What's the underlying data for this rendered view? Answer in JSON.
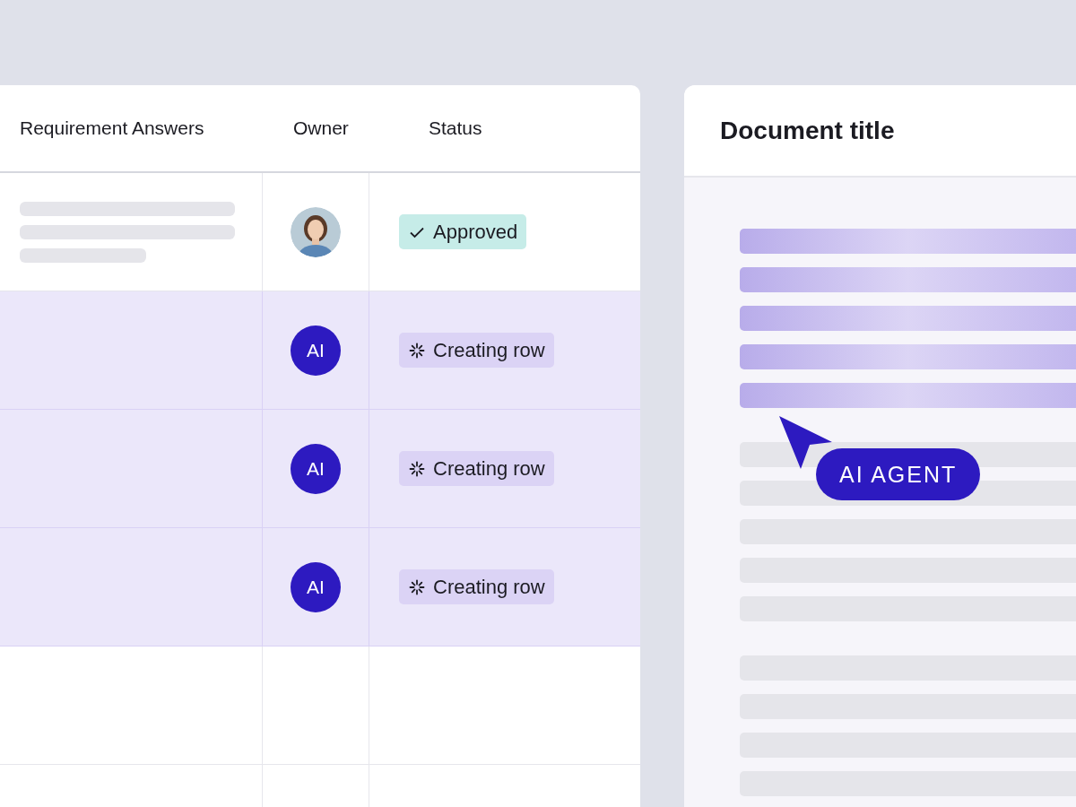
{
  "table": {
    "columns": [
      "Requirement Answers",
      "Owner",
      "Status"
    ],
    "rows": [
      {
        "highlighted": false,
        "answer": {
          "kind": "skeleton"
        },
        "owner": {
          "kind": "photo"
        },
        "status": {
          "kind": "approved",
          "label": "Approved"
        }
      },
      {
        "highlighted": true,
        "owner": {
          "kind": "ai",
          "label": "AI"
        },
        "status": {
          "kind": "creating",
          "label": "Creating row"
        }
      },
      {
        "highlighted": true,
        "owner": {
          "kind": "ai",
          "label": "AI"
        },
        "status": {
          "kind": "creating",
          "label": "Creating row"
        }
      },
      {
        "highlighted": true,
        "owner": {
          "kind": "ai",
          "label": "AI"
        },
        "status": {
          "kind": "creating",
          "label": "Creating row"
        }
      },
      {
        "highlighted": false
      },
      {
        "highlighted": false
      }
    ]
  },
  "document": {
    "title": "Document title",
    "paragraphs": [
      [
        {
          "highlighted": true
        },
        {
          "highlighted": true
        },
        {
          "highlighted": true
        },
        {
          "highlighted": true
        },
        {
          "highlighted": true
        }
      ],
      [
        {
          "highlighted": false
        },
        {
          "highlighted": false
        },
        {
          "highlighted": false
        },
        {
          "highlighted": false
        },
        {
          "highlighted": false
        }
      ],
      [
        {
          "highlighted": false
        },
        {
          "highlighted": false
        },
        {
          "highlighted": false
        },
        {
          "highlighted": false
        }
      ]
    ],
    "cursor": {
      "label": "AI AGENT"
    }
  }
}
